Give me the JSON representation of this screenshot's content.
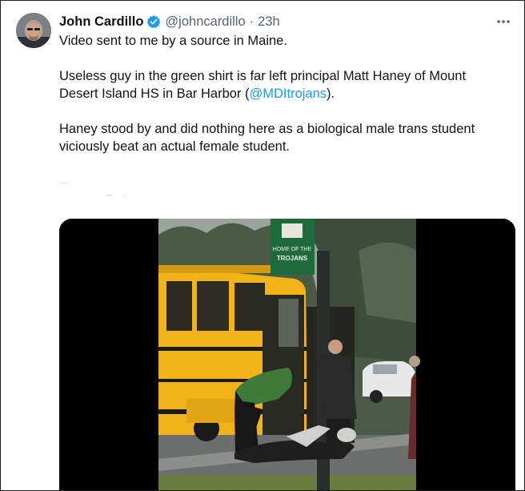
{
  "tweet": {
    "author_name": "John Cardillo",
    "handle": "@johncardillo",
    "separator": "·",
    "time": "23h",
    "paragraphs": {
      "p1": "Video sent to me by a source in Maine.",
      "p2_before": "Useless guy in the green shirt is far left principal Matt Haney of Mount Desert Island HS in Bar Harbor (",
      "p2_mention": "@MDItrojans",
      "p2_after": ").",
      "p3": "Haney stood by and did nothing here as a biological male trans student viciously beat an actual female student."
    }
  },
  "media": {
    "sign_text_line1": "HOME OF THE",
    "sign_text_line2": "TROJANS"
  },
  "icons": {
    "verified": "verified-badge-icon",
    "more": "more-options-icon"
  },
  "colors": {
    "accent": "#1d9bf0",
    "secondary_text": "#536471",
    "bus_yellow": "#f2b21a"
  }
}
